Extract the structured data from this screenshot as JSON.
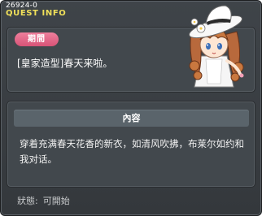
{
  "header": {
    "quest_id": "26924-0",
    "title": "QUEST INFO"
  },
  "quest": {
    "category": "期間",
    "name": "[皇家造型]春天来啦。"
  },
  "content": {
    "header_label": "內容",
    "description": "穿着充满春天花香的新衣，如清风吹拂，布莱尔如约和我对话。"
  },
  "status": {
    "label": "狀態:",
    "value": "可開始"
  },
  "colors": {
    "title_yellow": "#f0e05a",
    "badge_pink": "#e06585",
    "panel_bg": "#42484d",
    "window_bg": "#3a3e42"
  },
  "icons": {
    "npc": "npc-portrait-icon"
  }
}
